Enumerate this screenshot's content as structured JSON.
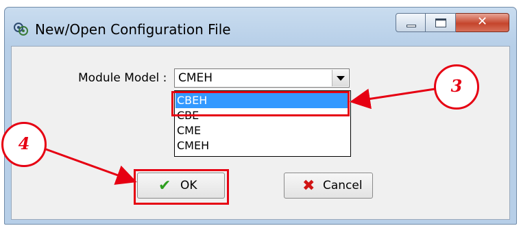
{
  "window": {
    "title": "New/Open  Configuration File",
    "caption_buttons": {
      "minimize": "minimize",
      "maximize": "maximize",
      "close": "close"
    }
  },
  "form": {
    "module_label": "Module Model :",
    "module_value": "CMEH",
    "options": [
      "CBEH",
      "CBE",
      "CME",
      "CMEH"
    ],
    "highlighted_option": "CBEH"
  },
  "buttons": {
    "ok_label": "OK",
    "cancel_label": "Cancel"
  },
  "annotations": {
    "step_3": "3",
    "step_4": "4",
    "color": "#e60012"
  },
  "colors": {
    "selection": "#3399ff",
    "ok_check": "#2e9e1f",
    "cancel_x": "#d01414"
  }
}
